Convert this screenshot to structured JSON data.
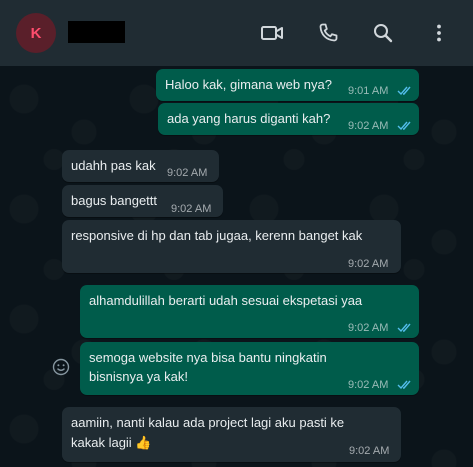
{
  "header": {
    "avatar_initial": "K",
    "contact_name": "redacted"
  },
  "messages": [
    {
      "text": "Haloo kak, gimana web nya?",
      "time": "9:01 AM",
      "direction": "out",
      "read": true
    },
    {
      "text": "ada yang harus diganti kah?",
      "time": "9:02 AM",
      "direction": "out",
      "read": true
    },
    {
      "text": "udahh pas kak",
      "time": "9:02 AM",
      "direction": "in"
    },
    {
      "text": "bagus bangettt",
      "time": "9:02 AM",
      "direction": "in"
    },
    {
      "text": "responsive di hp dan tab jugaa, kerenn banget kak",
      "time": "9:02 AM",
      "direction": "in"
    },
    {
      "text": "alhamdulillah berarti udah sesuai ekspetasi yaa",
      "time": "9:02 AM",
      "direction": "out",
      "read": true
    },
    {
      "line1": "semoga website nya bisa bantu ningkatin",
      "line2": "bisnisnya ya kak!",
      "time": "9:02 AM",
      "direction": "out",
      "read": true
    },
    {
      "line1": "aamiin, nanti kalau ada project lagi aku pasti ke",
      "line2": "kakak lagii 👍",
      "time": "9:02 AM",
      "direction": "in"
    }
  ],
  "colors": {
    "header_bg": "#202c33",
    "chat_bg": "#0b141a",
    "incoming_bubble": "#202c33",
    "outgoing_bubble": "#005c4b",
    "read_ticks": "#53bdeb",
    "avatar_text": "#ff4d6d"
  },
  "icons": [
    "video-call-icon",
    "voice-call-icon",
    "search-icon",
    "menu-icon",
    "emoji-icon",
    "read-receipt-icon"
  ]
}
